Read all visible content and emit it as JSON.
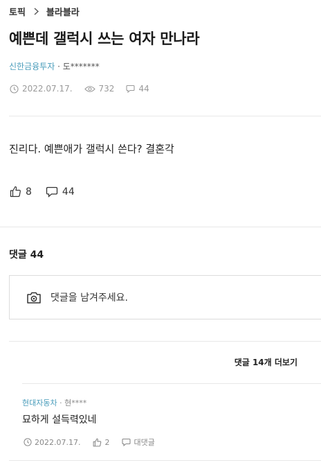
{
  "breadcrumb": {
    "topic": "토픽",
    "board": "블라블라"
  },
  "post": {
    "title": "예쁜데 갤럭시 쓰는 여자 만나라",
    "company": "신한금융투자",
    "author_sep": "·",
    "author": "도*******",
    "date": "2022.07.17.",
    "views": "732",
    "comments": "44",
    "body": "진리다. 예쁜애가 갤럭시 쓴다? 결혼각",
    "likes": "8",
    "comment_count_action": "44"
  },
  "comments_section": {
    "title": "댓글 44",
    "input_placeholder": "댓글을 남겨주세요.",
    "more_label": "댓글 14개 더보기"
  },
  "comment": {
    "company": "현대자동차",
    "author_sep": "·",
    "author": "현****",
    "text": "묘하게 설득력있네",
    "date": "2022.07.17.",
    "likes": "2",
    "reply_label": "대댓글"
  },
  "colors": {
    "company_link": "#4a9dbb",
    "meta_gray": "#9a9a9a",
    "divider": "#e8e8e8"
  },
  "icons": [
    "chevron-right-icon",
    "clock-icon",
    "eye-icon",
    "comment-icon",
    "thumbs-up-icon",
    "camera-icon"
  ]
}
